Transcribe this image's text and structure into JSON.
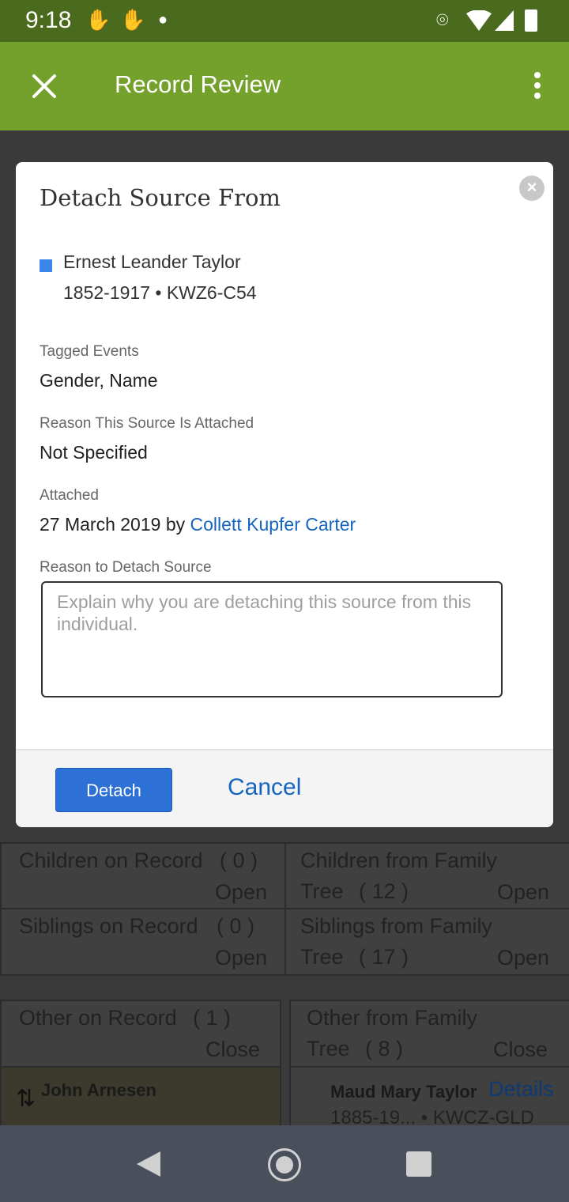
{
  "status_bar": {
    "time": "9:18"
  },
  "app_bar": {
    "title": "Record Review"
  },
  "background": {
    "children_on_record": "Children on Record",
    "children_on_record_count": "( 0 )",
    "children_on_record_action": "Open",
    "children_from_tree": "Children from Family",
    "children_from_tree_2": "Tree",
    "children_from_tree_count": "( 12 )",
    "children_from_tree_action": "Open",
    "siblings_on_record": "Siblings on Record",
    "siblings_on_record_count": "( 0 )",
    "siblings_on_record_action": "Open",
    "siblings_from_tree": "Siblings from Family",
    "siblings_from_tree_2": "Tree",
    "siblings_from_tree_count": "( 17 )",
    "siblings_from_tree_action": "Open",
    "other_on_record": "Other on Record",
    "other_on_record_count": "( 1 )",
    "other_on_record_action": "Close",
    "other_from_tree": "Other from Family",
    "other_from_tree_2": "Tree",
    "other_from_tree_count": "( 8 )",
    "other_from_tree_action": "Close",
    "person_left": "John Arnesen",
    "person_right": "Maud Mary Taylor",
    "person_right_link": "Details",
    "person_right_meta": "1885-19... • KWCZ-GLD"
  },
  "modal": {
    "title": "Detach Source From",
    "person_name": "Ernest Leander Taylor",
    "person_meta": "1852-1917 • KWZ6-C54",
    "tagged_events_label": "Tagged Events",
    "tagged_events_value": "Gender, Name",
    "reason_attached_label": "Reason This Source Is Attached",
    "reason_attached_value": "Not Specified",
    "attached_label": "Attached",
    "attached_date": "27 March 2019 by ",
    "attached_by": "Collett Kupfer Carter",
    "reason_detach_label": "Reason to Detach Source",
    "reason_detach_placeholder": "Explain why you are detaching this source from this individual.",
    "detach_button": "Detach",
    "cancel_button": "Cancel"
  },
  "colors": {
    "accent": "#73a12c",
    "primary": "#2d70d6",
    "link": "#1565c0"
  }
}
